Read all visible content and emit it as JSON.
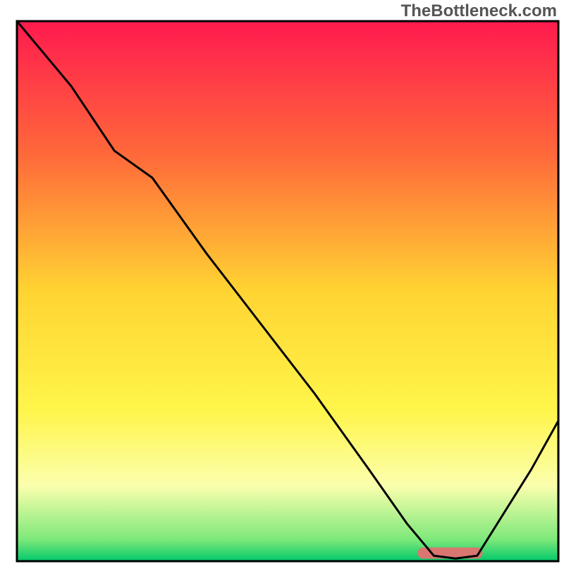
{
  "watermark": "TheBottleneck.com",
  "chart_data": {
    "type": "line",
    "title": "",
    "xlabel": "",
    "ylabel": "",
    "axes_visible": false,
    "xlim": [
      0,
      100
    ],
    "ylim": [
      0,
      100
    ],
    "background_gradient": {
      "stops": [
        {
          "pos": 0.0,
          "color": "#ff1a4f"
        },
        {
          "pos": 0.25,
          "color": "#ff6a3a"
        },
        {
          "pos": 0.5,
          "color": "#ffd432"
        },
        {
          "pos": 0.72,
          "color": "#fff54a"
        },
        {
          "pos": 0.86,
          "color": "#fbffad"
        },
        {
          "pos": 0.96,
          "color": "#7de87a"
        },
        {
          "pos": 1.0,
          "color": "#00c96a"
        }
      ]
    },
    "curve": {
      "comment": "Black curve — approximate bottleneck ratio. Lower = better. Minimum (~0) around x≈77–85.",
      "x": [
        0,
        10,
        18,
        25,
        35,
        45,
        55,
        65,
        72,
        77,
        81,
        85,
        90,
        95,
        100
      ],
      "y": [
        100,
        88,
        76,
        71,
        57,
        44,
        31,
        17,
        7,
        1,
        0.5,
        1,
        9,
        17,
        26
      ]
    },
    "minimum_band": {
      "comment": "Salmon rounded bar marking the optimal / minimum region.",
      "x_start": 74,
      "x_end": 86,
      "y": 1.5,
      "color": "#d8766f"
    },
    "frame": {
      "stroke": "#000000",
      "stroke_width": 3
    }
  }
}
